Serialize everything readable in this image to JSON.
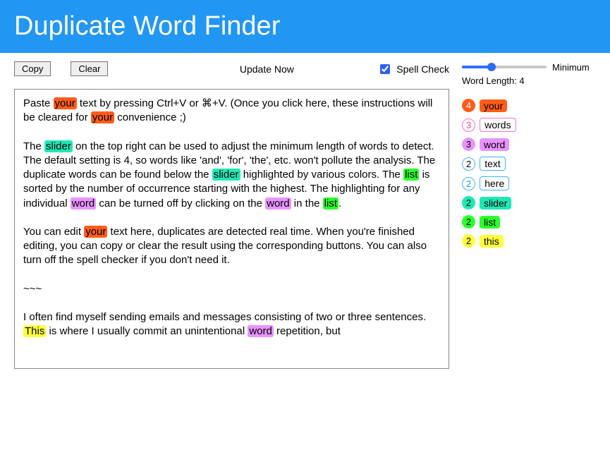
{
  "header": {
    "title": "Duplicate Word Finder"
  },
  "toolbar": {
    "copy_label": "Copy",
    "clear_label": "Clear",
    "update_now_label": "Update Now",
    "spellcheck_label": "Spell Check",
    "spellcheck_checked": true
  },
  "slider": {
    "minimum_label": "Minimum",
    "wordlen_label": "Word Length: 4",
    "value_pct": 35
  },
  "editor": {
    "para1": {
      "t1": "Paste ",
      "t2": " text by pressing Ctrl+V or ⌘+V. (Once you click here, these instructions will be cleared for ",
      "t3": " convenience ;)"
    },
    "para2": {
      "t1": "The ",
      "t2": " on the top right can be used to adjust the minimum length of words to detect. The default setting is 4, so words like 'and', 'for', 'the', etc. won't pollute the analysis. The duplicate words can be found below the ",
      "t3": " highlighted by various colors. The ",
      "t4": " is sorted by the number of occurrence starting with the highest. The highlighting for any individual ",
      "t5": " can be turned off by clicking on the ",
      "t6": " in the ",
      "t7": "."
    },
    "para3": {
      "t1": "You can edit ",
      "t2": " text here, duplicates are detected real time. When you're finished editing, you can copy or clear the result using the corresponding buttons. You can also turn off the spell checker if you don't need it."
    },
    "para4": {
      "t1": "~~~"
    },
    "para5": {
      "t1": "I often find myself sending emails and messages consisting of two or three sentences. ",
      "t2": " is where I usually commit an unintentional ",
      "t3": " repetition, but"
    },
    "hl": {
      "your": "your",
      "slider": "slider",
      "list": "list",
      "word": "word",
      "this": "This"
    }
  },
  "results": [
    {
      "count": "4",
      "word": "your",
      "count_class": "pill-orange-fill",
      "word_class": "pill-orange-word"
    },
    {
      "count": "3",
      "word": "words",
      "count_class": "pill-pink-out",
      "word_class": "pill-pink-word"
    },
    {
      "count": "3",
      "word": "word",
      "count_class": "pill-violet-fill",
      "word_class": "pill-violet-word"
    },
    {
      "count": "2",
      "word": "text",
      "count_class": "pill-blue-out",
      "word_class": "pill-blue-word"
    },
    {
      "count": "2",
      "word": "here",
      "count_class": "pill-bluefill-out",
      "word_class": "pill-bluefill-word"
    },
    {
      "count": "2",
      "word": "slider",
      "count_class": "pill-teal-fill",
      "word_class": "pill-teal-word"
    },
    {
      "count": "2",
      "word": "list",
      "count_class": "pill-lime-fill",
      "word_class": "pill-lime-word"
    },
    {
      "count": "2",
      "word": "this",
      "count_class": "pill-yellow-fill",
      "word_class": "pill-yellow-word"
    }
  ]
}
